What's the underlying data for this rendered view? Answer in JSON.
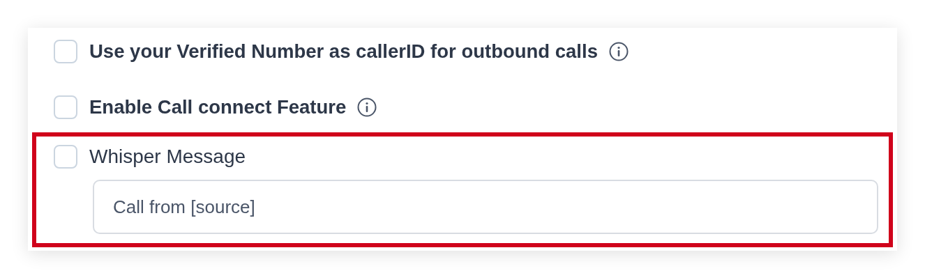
{
  "options": [
    {
      "kind": "checkbox",
      "label": "Use your Verified Number as callerID for outbound calls",
      "checked": false,
      "info": true,
      "highlighted": false
    },
    {
      "kind": "checkbox",
      "label": "Enable Call connect Feature",
      "checked": false,
      "info": true,
      "highlighted": false
    },
    {
      "kind": "checkbox_with_input",
      "label": "Whisper Message",
      "checked": false,
      "info": false,
      "highlighted": true,
      "value": "Call from [source]"
    }
  ]
}
